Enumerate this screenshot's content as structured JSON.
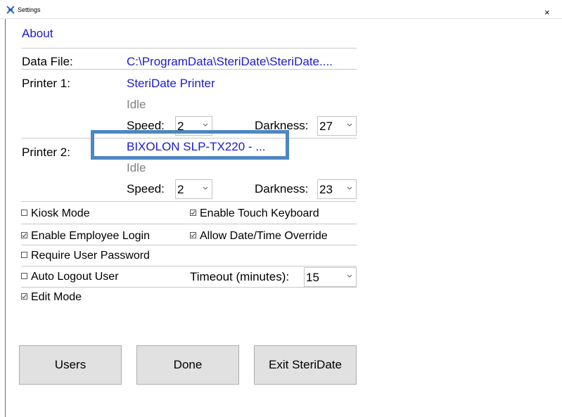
{
  "window": {
    "title": "Settings",
    "close_glyph": "×"
  },
  "about_link": "About",
  "data_file": {
    "label": "Data File:",
    "value": "C:\\ProgramData\\SteriDate\\SteriDate...."
  },
  "printer1": {
    "label": "Printer 1:",
    "name": "SteriDate Printer",
    "status": "Idle",
    "speed_label": "Speed:",
    "speed_value": "2",
    "darkness_label": "Darkness:",
    "darkness_value": "27"
  },
  "printer2": {
    "label": "Printer 2:",
    "name": "BIXOLON SLP-TX220 - ...",
    "status": "Idle",
    "speed_label": "Speed:",
    "speed_value": "2",
    "darkness_label": "Darkness:",
    "darkness_value": "23"
  },
  "options": {
    "kiosk_mode": {
      "label": "Kiosk Mode",
      "checked": false
    },
    "enable_touch_keyboard": {
      "label": "Enable Touch Keyboard",
      "checked": true
    },
    "enable_employee_login": {
      "label": "Enable Employee Login",
      "checked": true
    },
    "allow_datetime_override": {
      "label": "Allow Date/Time Override",
      "checked": true
    },
    "require_user_password": {
      "label": "Require User Password",
      "checked": false
    },
    "auto_logout_user": {
      "label": "Auto Logout User",
      "checked": false
    },
    "timeout_label": "Timeout (minutes):",
    "timeout_value": "15",
    "edit_mode": {
      "label": "Edit Mode",
      "checked": true
    }
  },
  "buttons": {
    "users": "Users",
    "done": "Done",
    "exit": "Exit SteriDate"
  },
  "colors": {
    "link_blue": "#1a1ad6",
    "highlight_border": "#4d86c2",
    "button_bg": "#e1e1e1"
  }
}
